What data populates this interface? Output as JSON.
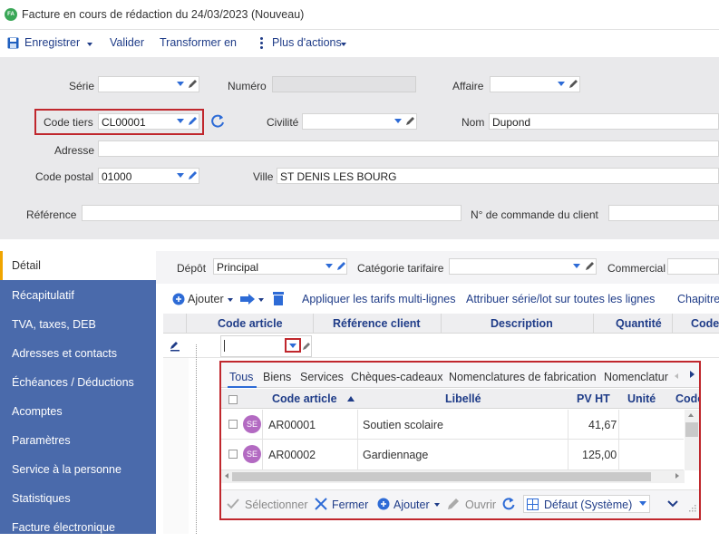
{
  "window": {
    "logo_text": "FA",
    "title": "Facture en cours de rédaction du 24/03/2023 (Nouveau)"
  },
  "toolbar": {
    "save": "Enregistrer",
    "validate": "Valider",
    "transform": "Transformer en",
    "more": "Plus d'actions"
  },
  "form": {
    "serie_label": "Série",
    "serie_value": "",
    "numero_label": "Numéro",
    "numero_value": "",
    "affaire_label": "Affaire",
    "affaire_value": "",
    "code_tiers_label": "Code tiers",
    "code_tiers_value": "CL00001",
    "civilite_label": "Civilité",
    "civilite_value": "",
    "nom_label": "Nom",
    "nom_value": "Dupond",
    "adresse_label": "Adresse",
    "adresse_value": "",
    "cp_label": "Code postal",
    "cp_value": "01000",
    "ville_label": "Ville",
    "ville_value": "ST DENIS LES BOURG",
    "reference_label": "Référence",
    "reference_value": "",
    "commande_label": "N° de commande du client",
    "commande_value": ""
  },
  "sidebar": {
    "items": [
      {
        "label": "Détail"
      },
      {
        "label": "Récapitulatif"
      },
      {
        "label": "TVA, taxes, DEB"
      },
      {
        "label": "Adresses et contacts"
      },
      {
        "label": "Échéances / Déductions"
      },
      {
        "label": "Acomptes"
      },
      {
        "label": "Paramètres"
      },
      {
        "label": "Service à la personne"
      },
      {
        "label": "Statistiques"
      },
      {
        "label": "Facture électronique"
      }
    ]
  },
  "detail": {
    "depot_label": "Dépôt",
    "depot_value": "Principal",
    "categorie_label": "Catégorie tarifaire",
    "categorie_value": "",
    "commercial_label": "Commercial",
    "commercial_value": "",
    "add_label": "Ajouter",
    "apply_tarifs": "Appliquer les tarifs multi-lignes",
    "attribuer": "Attribuer série/lot sur toutes les lignes",
    "chapitre": "Chapitre",
    "columns": [
      "Code article",
      "Référence client",
      "Description",
      "Quantité",
      "Code"
    ]
  },
  "popup": {
    "tabs": [
      "Tous",
      "Biens",
      "Services",
      "Chèques-cadeaux",
      "Nomenclatures de fabrication",
      "Nomenclatur"
    ],
    "columns": {
      "code": "Code article",
      "libelle": "Libellé",
      "pvht": "PV HT",
      "unite": "Unité",
      "code2": "Code"
    },
    "rows": [
      {
        "badge": "SE",
        "code": "AR00001",
        "libelle": "Soutien scolaire",
        "pvht": "41,67",
        "unite": ""
      },
      {
        "badge": "SE",
        "code": "AR00002",
        "libelle": "Gardiennage",
        "pvht": "125,00",
        "unite": ""
      }
    ],
    "footer": {
      "select": "Sélectionner",
      "close": "Fermer",
      "add": "Ajouter",
      "open": "Ouvrir",
      "view": "Défaut (Système)"
    }
  },
  "colors": {
    "accent": "#1f3c88",
    "sidebar": "#4a6aab",
    "highlight": "#c0272d",
    "active_marker": "#f0a500"
  }
}
